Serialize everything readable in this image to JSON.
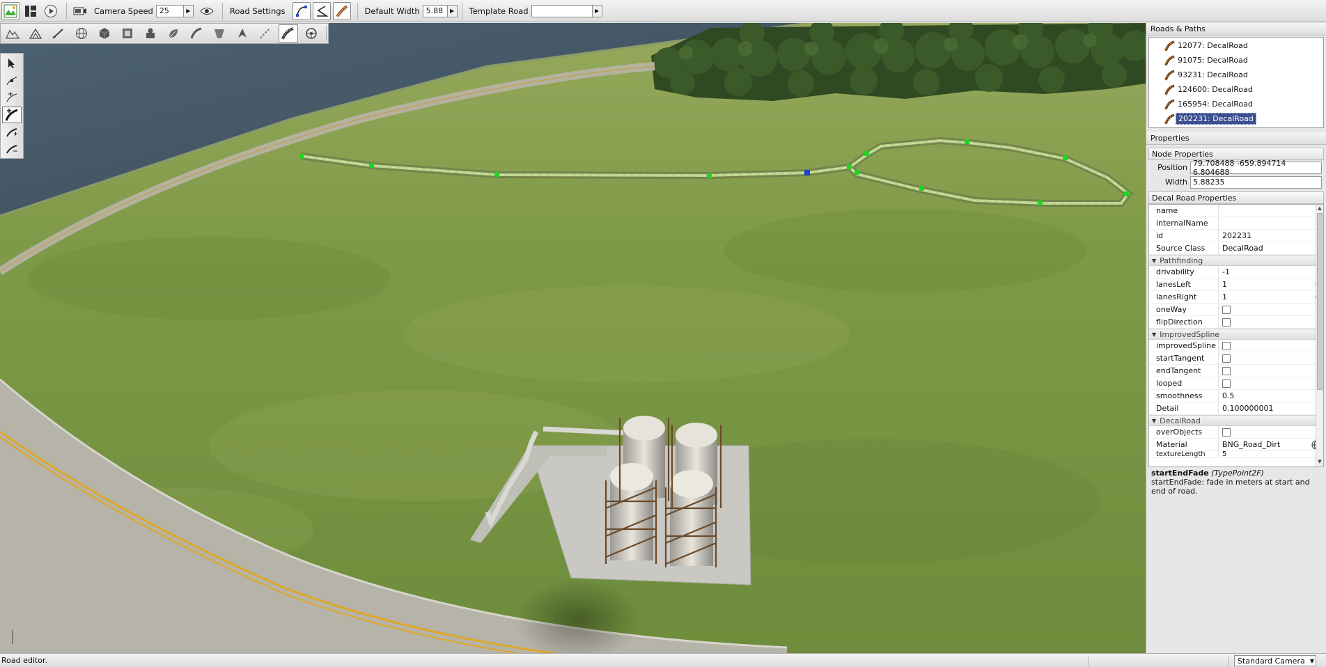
{
  "toolbar": {
    "camera_speed_label": "Camera Speed",
    "camera_speed_value": "25",
    "road_settings_label": "Road Settings",
    "default_width_label": "Default Width",
    "default_width_value": "5.88",
    "template_road_label": "Template Road",
    "template_road_value": ""
  },
  "roads_panel": {
    "title": "Roads & Paths",
    "items": [
      {
        "label": "12077: DecalRoad"
      },
      {
        "label": "91075: DecalRoad"
      },
      {
        "label": "93231: DecalRoad"
      },
      {
        "label": "124600: DecalRoad"
      },
      {
        "label": "165954: DecalRoad"
      },
      {
        "label": "202231: DecalRoad",
        "selected": true
      }
    ]
  },
  "properties_panel": {
    "title": "Properties",
    "node_props_title": "Node Properties",
    "position_label": "Position",
    "position_value": "79.708488 -659.894714 6.804688",
    "width_label": "Width",
    "width_value": "5.88235",
    "decal_props_title": "Decal Road Properties",
    "rows_general": [
      {
        "key": "name",
        "value": ""
      },
      {
        "key": "internalName",
        "value": ""
      },
      {
        "key": "id",
        "value": "202231"
      },
      {
        "key": "Source Class",
        "value": "DecalRoad"
      }
    ],
    "group_pathfinding": "Pathfinding",
    "rows_pathfinding": {
      "drivability": {
        "key": "drivability",
        "value": "-1"
      },
      "lanesLeft": {
        "key": "lanesLeft",
        "value": "1"
      },
      "lanesRight": {
        "key": "lanesRight",
        "value": "1"
      },
      "oneWay": {
        "key": "oneWay"
      },
      "flipDirection": {
        "key": "flipDirection"
      }
    },
    "group_improved": "ImprovedSpline",
    "rows_improved": {
      "improvedSpline": {
        "key": "improvedSpline"
      },
      "startTangent": {
        "key": "startTangent"
      },
      "endTangent": {
        "key": "endTangent"
      },
      "looped": {
        "key": "looped"
      },
      "smoothness": {
        "key": "smoothness",
        "value": "0.5"
      },
      "detail": {
        "key": "Detail",
        "value": "0.100000001"
      }
    },
    "group_decal": "DecalRoad",
    "rows_decal": {
      "overObjects": {
        "key": "overObjects"
      },
      "material": {
        "key": "Material",
        "value": "BNG_Road_Dirt"
      },
      "texture_length": {
        "key": "textureLength",
        "value": "5"
      }
    },
    "help_title": "startEndFade",
    "help_type": "(TypePoint2F)",
    "help_text": "startEndFade: fade in meters at start and end of road."
  },
  "status_bar": {
    "message": "Road editor.",
    "camera_mode": "Standard Camera"
  },
  "icons": [
    "world-editor-icon",
    "panel-icon",
    "play-icon",
    "camera-icon",
    "eye-icon",
    "road-tool-icons",
    "globe-icon"
  ]
}
